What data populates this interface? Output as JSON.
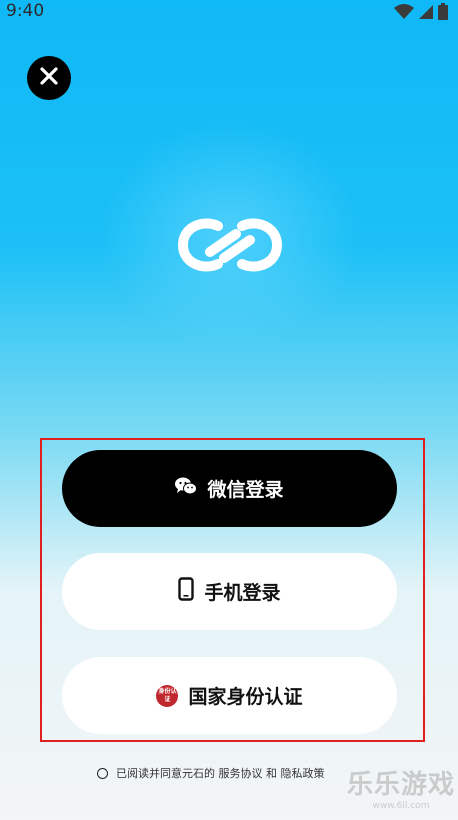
{
  "status_bar": {
    "time": "9:40"
  },
  "buttons": {
    "wechat_label": "微信登录",
    "phone_label": "手机登录",
    "id_label": "国家身份认证",
    "id_badge_text": "身份认证"
  },
  "agreement": {
    "prefix": "已阅读并同意元石的",
    "terms_link": "服务协议",
    "conjunction": "和",
    "privacy_link": "隐私政策"
  },
  "watermark": {
    "title": "乐乐游戏",
    "url": "www.6ll.com"
  },
  "colors": {
    "primary_button": "#000000",
    "highlight_border": "#e0201e",
    "id_badge": "#c0282d"
  },
  "icons": [
    "wifi-icon",
    "signal-icon",
    "battery-icon",
    "close-icon",
    "app-logo-icon",
    "wechat-icon",
    "phone-icon",
    "id-badge-icon"
  ]
}
